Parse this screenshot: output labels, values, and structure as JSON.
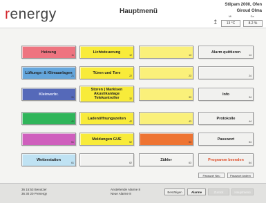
{
  "header": {
    "logo_prefix": "r",
    "logo_rest": "energy",
    "title": "Hauptmenü",
    "clock_line1": "Stilpam 2000, Ofen",
    "clock_line2": "Giroud Olma"
  },
  "climate": {
    "symbol": "↥",
    "label1": "Mi",
    "value1": "13 °C",
    "label2": "Sa",
    "value2": "8.2 %"
  },
  "grid": {
    "col1": [
      {
        "label": "Heizung",
        "num": "11",
        "color": "#ee7480",
        "text_color": "#222"
      },
      {
        "label": "Lüftungs- & Klimaanlagen",
        "num": "21",
        "color": "#64a6dc",
        "text_color": "#222"
      },
      {
        "label": "Kleinverbr.",
        "num": "31",
        "color": "#5569b9",
        "text_color": "#e8ecff"
      },
      {
        "label": "",
        "num": "41",
        "color": "#2fb55a",
        "text_color": "#222"
      },
      {
        "label": "",
        "num": "51",
        "color": "#cf5fbd",
        "text_color": "#222"
      },
      {
        "label": "Wetterstation",
        "num": "61",
        "color": "#bfe2f3",
        "text_color": "#222"
      }
    ],
    "col2": [
      {
        "label": "Lichtsteuerung",
        "num": "12",
        "color": "#f8eb3a",
        "text_color": "#222"
      },
      {
        "label": "Türen und Tore",
        "num": "22",
        "color": "#f8eb3a",
        "text_color": "#222"
      },
      {
        "label": "Storen | Markisen Akustikanlage Telekontroller",
        "num": "32",
        "color": "#f8eb3a",
        "text_color": "#222"
      },
      {
        "label": "Ladenöffnungszeiten",
        "num": "42",
        "color": "#f8eb3a",
        "text_color": "#222"
      },
      {
        "label": "Meldungen GUE",
        "num": "52",
        "color": "#f8eb3a",
        "text_color": "#222"
      },
      {
        "label": "",
        "num": "62",
        "color": "#f1f1ef",
        "text_color": "#222"
      }
    ],
    "col3": [
      {
        "label": "",
        "num": "13",
        "color": "#faf07a",
        "text_color": "#222"
      },
      {
        "label": "",
        "num": "23",
        "color": "#faf07a",
        "text_color": "#222"
      },
      {
        "label": "",
        "num": "33",
        "color": "#faf07a",
        "text_color": "#222"
      },
      {
        "label": "",
        "num": "43",
        "color": "#faf07a",
        "text_color": "#222"
      },
      {
        "label": "",
        "num": "53",
        "color": "#ee7432",
        "text_color": "#222"
      },
      {
        "label": "Zähler",
        "num": "63",
        "color": "#f3f3f1",
        "text_color": "#222"
      }
    ],
    "col4": [
      {
        "label": "Alarm quittieren",
        "num": "14",
        "color": "#f1f1ef",
        "text_color": "#222"
      },
      {
        "label": "",
        "num": "24",
        "color": "#f1f1ef",
        "text_color": "#222"
      },
      {
        "label": "Info",
        "num": "34",
        "color": "#f1f1ef",
        "text_color": "#222"
      },
      {
        "label": "Protokolle",
        "num": "44",
        "color": "#f1f1ef",
        "text_color": "#222"
      },
      {
        "label": "Passwort",
        "num": "54",
        "color": "#f1f1ef",
        "text_color": "#222"
      },
      {
        "label": "Programm beenden",
        "num": "64",
        "color": "#f1f1ef",
        "text_color": "#e0502d"
      }
    ]
  },
  "small_buttons": {
    "left": "Passwort Neu",
    "right": "Passwort ändern"
  },
  "footer": {
    "log_line1": "36 15:53  Benutzer",
    "log_line2": "36 30 20  Prenergy",
    "alarm_line1": "Anstehende Alarme   8",
    "alarm_line2": "Neue Alarme            8",
    "btn_ack": "Bestätigen",
    "btn_alarms": "Alarme",
    "btn_back": "Zurück",
    "btn_home": "Hauptmenü"
  }
}
